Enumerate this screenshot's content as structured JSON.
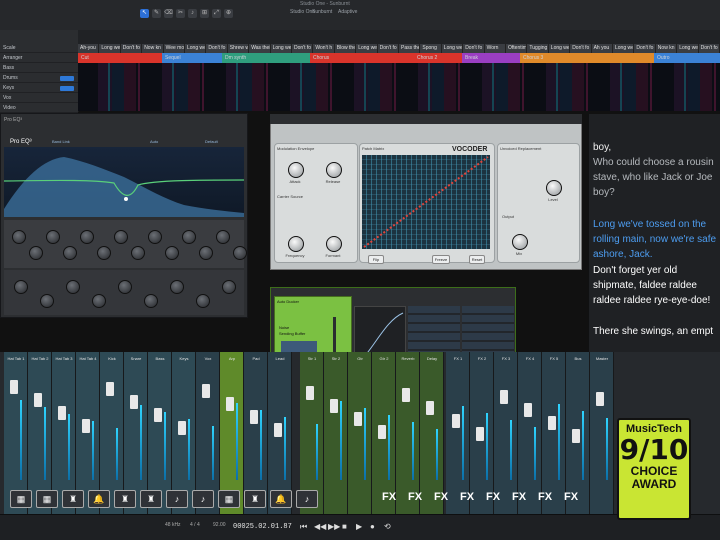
{
  "window": {
    "title": "Studio One - Sunburnt"
  },
  "toolbar": {
    "tools": [
      "↖",
      "✎",
      "⌫",
      "✂",
      "♪",
      "⊞",
      "⤢",
      "⊕"
    ],
    "readouts": [
      "Studio One",
      "Sunburnt",
      "Adaptive"
    ]
  },
  "tracks": [
    {
      "name": "Scale"
    },
    {
      "name": "Arranger"
    },
    {
      "name": "Bass"
    },
    {
      "name": "Drums"
    },
    {
      "name": "Keys"
    },
    {
      "name": "Vox"
    },
    {
      "name": "Video"
    }
  ],
  "lyric_track": [
    "Ah-you",
    "Long we",
    "Don't fo",
    "Now kn",
    "Wee mon",
    "Long we",
    "Don't fo",
    "Shrew won",
    "Was thei",
    "Long we",
    "Don't fo",
    "Won't h",
    "Blow thes",
    "Long we",
    "Don't fo",
    "Pass the",
    "Spong",
    "Long we",
    "Don't fo",
    "Worn",
    "Oftentim",
    "Tugging",
    "Long we",
    "Don't fo",
    "Ah you",
    "Long we",
    "Don't fo",
    "Now kn",
    "Long we",
    "Don't fo"
  ],
  "arranger": [
    {
      "label": "Cut",
      "color": "#d9342b"
    },
    {
      "label": "Sequel",
      "color": "#3b82d6"
    },
    {
      "label": "Dm synth",
      "color": "#2f9e7e"
    },
    {
      "label": "Chorus",
      "color": "#d9342b"
    },
    {
      "label": "Chorus 2",
      "color": "#d9342b"
    },
    {
      "label": "Break",
      "color": "#9a3ec2"
    },
    {
      "label": "Chorus 3",
      "color": "#e08a2a"
    },
    {
      "label": "Outro",
      "color": "#3b82d6"
    }
  ],
  "lyrics": {
    "lines": [
      {
        "text": "boy,",
        "color": "#f2f2f2"
      },
      {
        "text": "Who could choose a rousin",
        "color": "#b5b9bd"
      },
      {
        "text": "stave, who like Jack or Joe",
        "color": "#b5b9bd"
      },
      {
        "text": "boy?",
        "color": "#b5b9bd"
      },
      {
        "text": "Long we've tossed on the",
        "color": "#4d9df0"
      },
      {
        "text": "rolling main, now we're safe",
        "color": "#4d9df0"
      },
      {
        "text": "ashore, Jack.",
        "color": "#4d9df0"
      },
      {
        "text": "Don't forget yer old",
        "color": "#ffffff"
      },
      {
        "text": "shipmate, faldee raldee",
        "color": "#ffffff"
      },
      {
        "text": "raldee raldee rye-eye-doe!",
        "color": "#ffffff"
      },
      {
        "text": "There she swings, an empt",
        "color": "#ffffff"
      }
    ]
  },
  "pro_eq": {
    "title": "Pro EQ³",
    "tabs": [
      "Band Link",
      "Auto",
      "Default"
    ]
  },
  "vocoder": {
    "title": "VOCODER",
    "sections": {
      "modulation": "Modulation Envelope",
      "carrier": "Carrier Source",
      "patch": "Patch Matrix",
      "unvoiced": "Unvoiced Replacement",
      "output": "Output"
    },
    "knobs": [
      "Attack",
      "Release",
      "Frequency",
      "Formant",
      "Mix",
      "Level"
    ],
    "buttons": [
      "Flip",
      "Freeze",
      "Reset"
    ]
  },
  "sidechain": {
    "title": "Auto Ducker",
    "labels": [
      "Noise",
      "Sending Buffer"
    ]
  },
  "mixer": {
    "channels": [
      {
        "name": "Hat Tab 1"
      },
      {
        "name": "Hat Tab 2"
      },
      {
        "name": "Hat Tab 3"
      },
      {
        "name": "Hat Tab 4"
      },
      {
        "name": "Kick"
      },
      {
        "name": "Snare"
      },
      {
        "name": "Bass"
      },
      {
        "name": "Keys"
      },
      {
        "name": "Vox"
      },
      {
        "name": "Arp"
      },
      {
        "name": "Pad"
      },
      {
        "name": "Lead"
      },
      {
        "name": "Str 1"
      },
      {
        "name": "Str 2"
      },
      {
        "name": "Gtr"
      },
      {
        "name": "Gtr 2"
      },
      {
        "name": "Reverb"
      },
      {
        "name": "Delay"
      },
      {
        "name": "FX 1"
      },
      {
        "name": "FX 2"
      },
      {
        "name": "FX 3"
      },
      {
        "name": "FX 4"
      },
      {
        "name": "FX 5"
      },
      {
        "name": "Bus"
      },
      {
        "name": "Master"
      }
    ],
    "instrument_icons": [
      "▦",
      "▦",
      "♜",
      "🔔",
      "♜",
      "♜",
      "♪",
      "♪",
      "▦",
      "♜",
      "🔔",
      "♪"
    ],
    "fx_labels": [
      "FX",
      "FX",
      "FX",
      "FX",
      "FX",
      "FX",
      "FX",
      "FX"
    ]
  },
  "transport": {
    "time": "00025.02.01.87",
    "bpm": "92.00",
    "signature": "4 / 4",
    "sample_rate": "48 kHz",
    "buttons": [
      "⏮",
      "◀◀",
      "▶▶",
      "■",
      "▶",
      "●",
      "⟲"
    ]
  },
  "badge": {
    "brand": "MusicTech",
    "score": "9/10",
    "line1": "CHOICE",
    "line2": "AWARD"
  }
}
